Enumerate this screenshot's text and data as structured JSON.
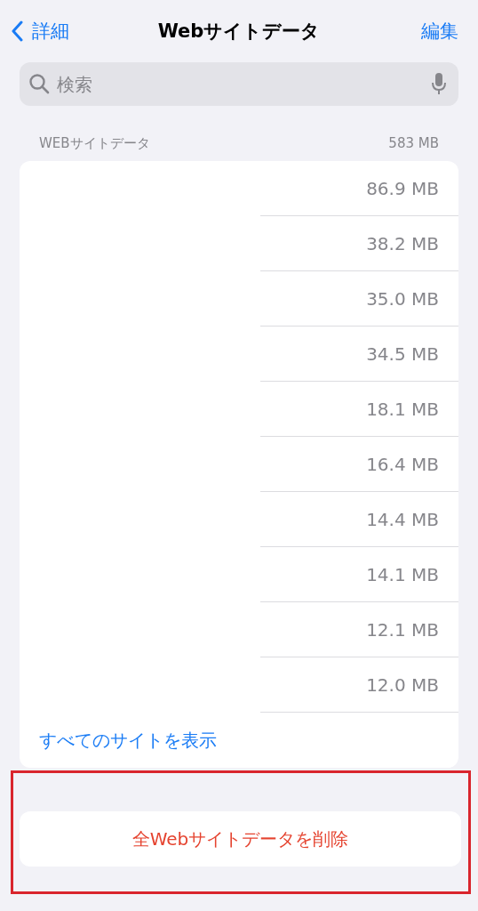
{
  "nav": {
    "back": "詳細",
    "title": "Webサイトデータ",
    "edit": "編集"
  },
  "search": {
    "placeholder": "検索"
  },
  "section": {
    "header": "WEBサイトデータ",
    "total": "583 MB"
  },
  "rows": [
    {
      "size": "86.9 MB"
    },
    {
      "size": "38.2 MB"
    },
    {
      "size": "35.0 MB"
    },
    {
      "size": "34.5 MB"
    },
    {
      "size": "18.1 MB"
    },
    {
      "size": "16.4 MB"
    },
    {
      "size": "14.4 MB"
    },
    {
      "size": "14.1 MB"
    },
    {
      "size": "12.1 MB"
    },
    {
      "size": "12.0 MB"
    }
  ],
  "show_all": "すべてのサイトを表示",
  "delete_button": {
    "label": "全Webサイトデータを削除",
    "highlighted": true
  }
}
